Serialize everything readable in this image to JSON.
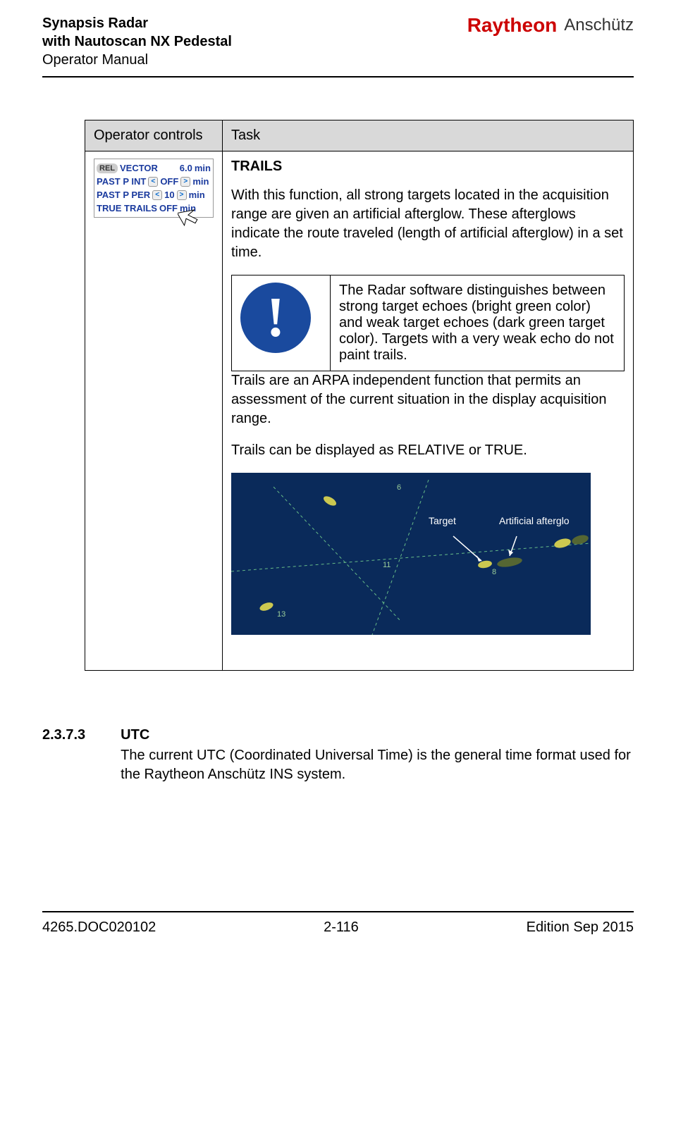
{
  "header": {
    "line1": "Synapsis Radar",
    "line2": "with Nautoscan NX Pedestal",
    "line3": "Operator Manual",
    "brand1": "Raytheon",
    "brand2": "Anschütz"
  },
  "table": {
    "col1": "Operator controls",
    "col2": "Task",
    "control": {
      "row1_badge": "REL",
      "row1_text": "VECTOR",
      "row1_val": "6.0",
      "row1_unit": "min",
      "row2_label": "PAST P INT",
      "row2_val": "OFF",
      "row2_unit": "min",
      "row3_label": "PAST P PER",
      "row3_val": "10",
      "row3_unit": "min",
      "row4_label": "TRUE TRAILS",
      "row4_val": "OFF",
      "row4_unit": "min"
    },
    "task": {
      "title": "TRAILS",
      "para1": "With this function, all strong targets located in the acquisition range are given an artificial afterglow. These afterglows indicate the route traveled (length of artificial afterglow) in a set time.",
      "note": "The Radar software distinguishes between strong target echoes (bright green color) and weak target echoes (dark green target color). Targets with a very weak echo do not paint trails.",
      "para2": "Trails are an ARPA independent function that permits an assessment of the current situation in the display acquisition range.",
      "para3": "Trails can be displayed as RELATIVE or TRUE.",
      "radar_label_target": "Target",
      "radar_label_afterglow": "Artificial afterglo",
      "radar_num_6": "6",
      "radar_num_8": "8",
      "radar_num_11": "11",
      "radar_num_13": "13"
    }
  },
  "section": {
    "num": "2.3.7.3",
    "title": "UTC",
    "body": "The current UTC (Coordinated Universal Time) is the general time format used for the Raytheon Anschütz INS system."
  },
  "footer": {
    "left": "4265.DOC020102",
    "center": "2-116",
    "right": "Edition Sep 2015"
  }
}
